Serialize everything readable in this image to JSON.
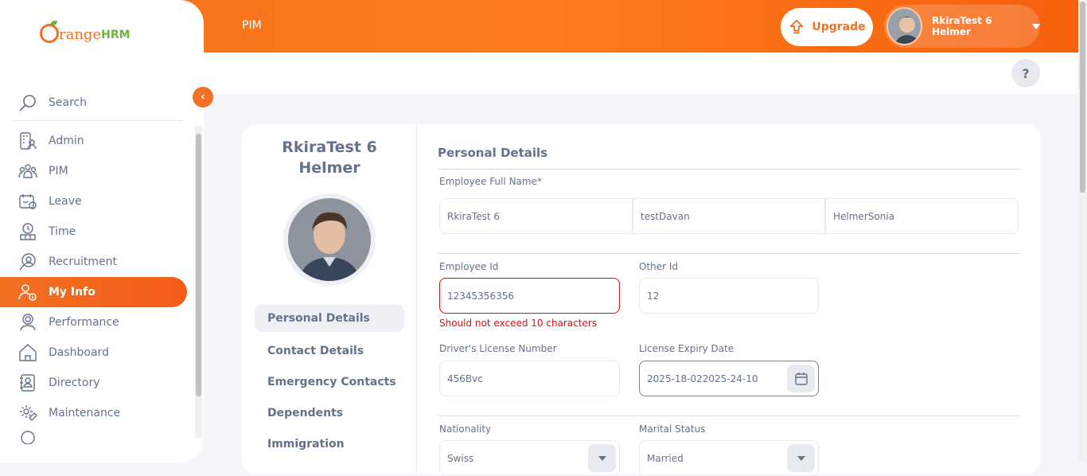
{
  "app": {
    "brand_left": "range",
    "brand_right": "HRM"
  },
  "header": {
    "module": "PIM",
    "upgrade_label": "Upgrade",
    "user_name": "RkiraTest 6 Helmer",
    "help_label": "?"
  },
  "sidebar": {
    "search_label": "Search",
    "items": [
      {
        "label": "Admin",
        "icon": "admin-icon"
      },
      {
        "label": "PIM",
        "icon": "pim-icon"
      },
      {
        "label": "Leave",
        "icon": "leave-icon"
      },
      {
        "label": "Time",
        "icon": "time-icon"
      },
      {
        "label": "Recruitment",
        "icon": "recruitment-icon"
      },
      {
        "label": "My Info",
        "icon": "myinfo-icon",
        "active": true
      },
      {
        "label": "Performance",
        "icon": "performance-icon"
      },
      {
        "label": "Dashboard",
        "icon": "dashboard-icon"
      },
      {
        "label": "Directory",
        "icon": "directory-icon"
      },
      {
        "label": "Maintenance",
        "icon": "maintenance-icon"
      }
    ]
  },
  "employee": {
    "name_line1": "RkiraTest 6",
    "name_line2": "Helmer"
  },
  "tabs": [
    {
      "label": "Personal Details",
      "active": true
    },
    {
      "label": "Contact Details"
    },
    {
      "label": "Emergency Contacts"
    },
    {
      "label": "Dependents"
    },
    {
      "label": "Immigration"
    }
  ],
  "form": {
    "title": "Personal Details",
    "full_name_label": "Employee Full Name*",
    "first_name": "RkiraTest 6",
    "middle_name": "testDavan",
    "last_name": "HelmerSonia",
    "employee_id_label": "Employee Id",
    "employee_id": "12345356356",
    "employee_id_error": "Should not exceed 10 characters",
    "other_id_label": "Other Id",
    "other_id": "12",
    "license_label": "Driver's License Number",
    "license": "456Bvc",
    "expiry_label": "License Expiry Date",
    "expiry": "2025-18-022025-24-10",
    "nationality_label": "Nationality",
    "nationality": "Swiss",
    "marital_label": "Marital Status",
    "marital": "Married"
  },
  "colors": {
    "brand_orange": "#f27023",
    "brand_green": "#6cb33f",
    "error_red": "#eb0910",
    "text": "#64728c"
  }
}
